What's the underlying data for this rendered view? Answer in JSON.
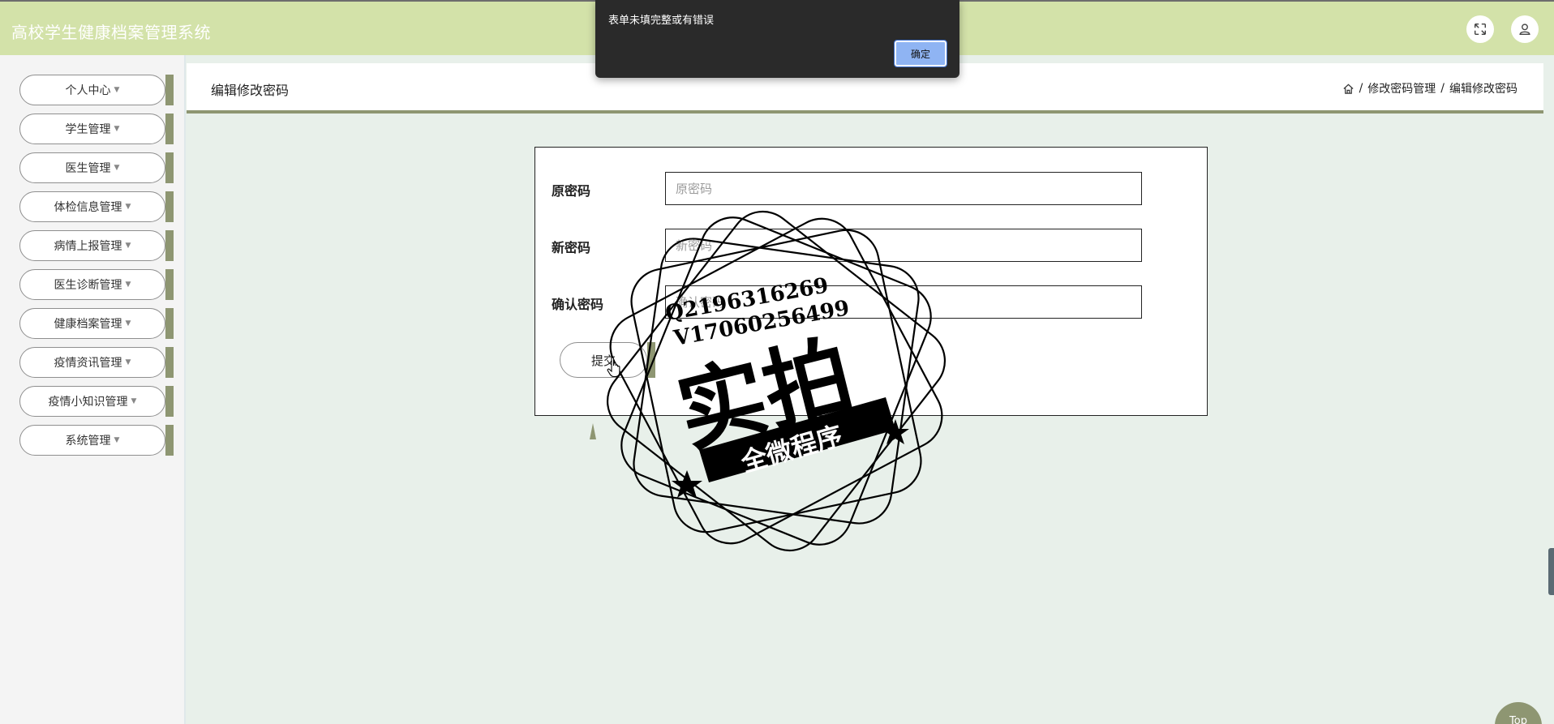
{
  "header": {
    "app_title": "高校学生健康档案管理系统",
    "icons": [
      "fullscreen-icon",
      "user-icon"
    ]
  },
  "sidebar": {
    "items": [
      {
        "label": "个人中心"
      },
      {
        "label": "学生管理"
      },
      {
        "label": "医生管理"
      },
      {
        "label": "体检信息管理"
      },
      {
        "label": "病情上报管理"
      },
      {
        "label": "医生诊断管理"
      },
      {
        "label": "健康档案管理"
      },
      {
        "label": "疫情资讯管理"
      },
      {
        "label": "疫情小知识管理"
      },
      {
        "label": "系统管理"
      }
    ]
  },
  "breadcrumb": {
    "page_title": "编辑修改密码",
    "separator": "/",
    "path": [
      "修改密码管理",
      "编辑修改密码"
    ]
  },
  "form": {
    "fields": [
      {
        "label": "原密码",
        "placeholder": "原密码",
        "value": ""
      },
      {
        "label": "新密码",
        "placeholder": "新密码",
        "value": ""
      },
      {
        "label": "确认密码",
        "placeholder": "确认密码",
        "value": ""
      }
    ],
    "submit_label": "提交"
  },
  "alert": {
    "message": "表单未填完整或有错误",
    "ok_label": "确定"
  },
  "watermark": {
    "line1": "Q2196316269",
    "line2": "V17060256499",
    "main": "实拍",
    "ribbon": "全微程序"
  },
  "back_to_top": "Top",
  "colors": {
    "header_bg": "#d3e2a9",
    "accent": "#8e9672",
    "page_bg": "#e8f0ea",
    "alert_bg": "#2a2a2a",
    "ok_button": "#8fb4f3"
  }
}
